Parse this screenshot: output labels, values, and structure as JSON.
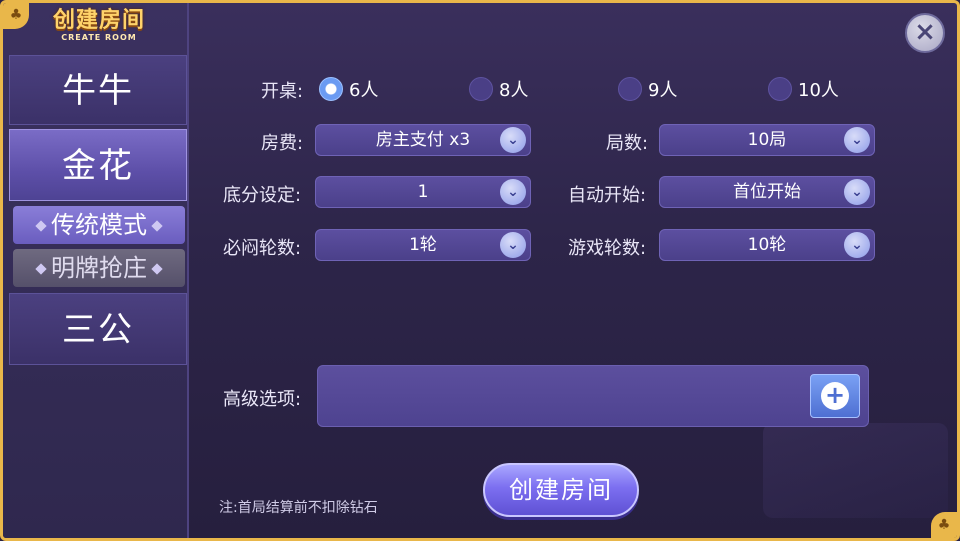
{
  "logo": {
    "title_cn": "创建房间",
    "title_en": "CREATE ROOM"
  },
  "sidebar": {
    "tabs": [
      {
        "label": "牛牛"
      },
      {
        "label": "金花"
      },
      {
        "label": "三公"
      }
    ],
    "sub_modes": [
      {
        "label": "传统模式"
      },
      {
        "label": "明牌抢庄"
      }
    ]
  },
  "close_icon": "×",
  "form": {
    "table": {
      "label": "开桌:",
      "options": [
        {
          "label": "6人",
          "checked": true
        },
        {
          "label": "8人",
          "checked": false
        },
        {
          "label": "9人",
          "checked": false
        },
        {
          "label": "10人",
          "checked": false
        }
      ]
    },
    "fee": {
      "label": "房费:",
      "value": "房主支付 x3"
    },
    "rounds": {
      "label": "局数:",
      "value": "10局"
    },
    "base_score": {
      "label": "底分设定:",
      "value": "1"
    },
    "auto_start": {
      "label": "自动开始:",
      "value": "首位开始"
    },
    "must_blind": {
      "label": "必闷轮数:",
      "value": "1轮"
    },
    "game_rounds": {
      "label": "游戏轮数:",
      "value": "10轮"
    },
    "advanced": {
      "label": "高级选项:"
    }
  },
  "create_button": "创建房间",
  "note": "注:首局结算前不扣除钻石",
  "colors": {
    "accent_gold": "#e9b74a",
    "panel": "#2d2549",
    "active_tab": "#6a5dbf"
  }
}
